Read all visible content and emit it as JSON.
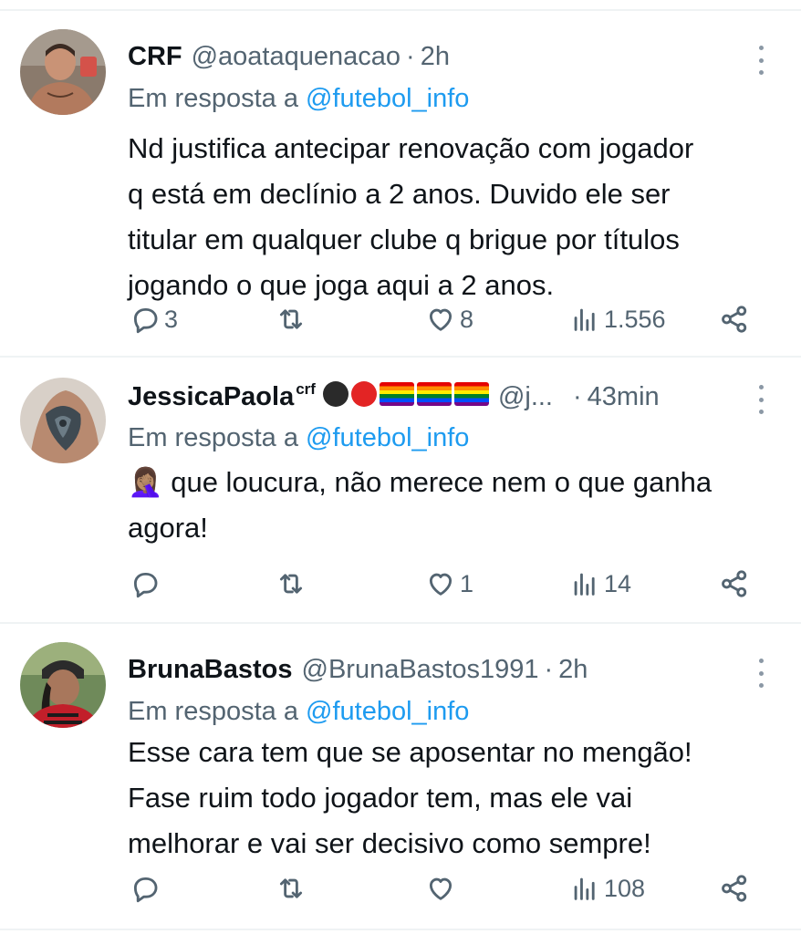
{
  "tweets": [
    {
      "name": "CRF",
      "handle": "@aoataquenacao",
      "time": "2h",
      "reply_prefix": "Em resposta a ",
      "reply_to": "@futebol_info",
      "lines": [
        "Nd justifica antecipar renovação com jogador",
        "q está em declínio a 2 anos. Duvido ele ser",
        "titular em qualquer clube q brigue por títulos",
        "jogando o que joga aqui a 2 anos."
      ],
      "replies": "3",
      "retweets": "",
      "likes": "8",
      "views": "1.556"
    },
    {
      "name": "JessicaPaola",
      "name_sup": "crf",
      "name_emojis": [
        "black-circle",
        "red-circle",
        "rainbow-flag",
        "rainbow-flag",
        "rainbow-flag"
      ],
      "handle": "@j...",
      "time": "43min",
      "reply_prefix": "Em resposta a ",
      "reply_to": "@futebol_info",
      "emoji_prefix": "🤦🏽‍♀️",
      "lines": [
        " que loucura, não merece nem o que ganha",
        "agora!"
      ],
      "replies": "",
      "retweets": "",
      "likes": "1",
      "views": "14"
    },
    {
      "name": "BrunaBastos",
      "handle": "@BrunaBastos1991",
      "time": "2h",
      "reply_prefix": "Em resposta a ",
      "reply_to": "@futebol_info",
      "lines": [
        "Esse cara tem que se aposentar no mengão!",
        "Fase ruim todo jogador tem, mas ele vai",
        "melhorar e vai ser decisivo como sempre!"
      ],
      "replies": "",
      "retweets": "",
      "likes": "",
      "views": "108"
    }
  ],
  "separator": "·",
  "icons": {
    "reply": "reply-icon",
    "retweet": "retweet-icon",
    "like": "heart-icon",
    "views": "views-icon",
    "share": "share-icon",
    "more": "more-icon"
  },
  "colors": {
    "text": "#0f1419",
    "muted": "#536471",
    "mention": "#1d9bf0",
    "divider": "#eff3f4"
  }
}
